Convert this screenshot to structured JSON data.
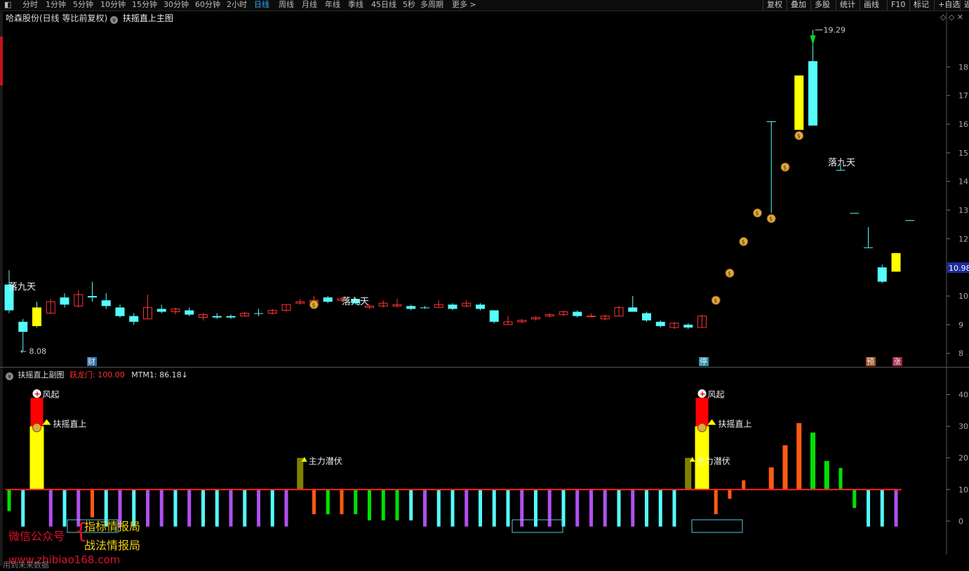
{
  "toolbar": {
    "periods": [
      "分时",
      "1分钟",
      "5分钟",
      "10分钟",
      "15分钟",
      "30分钟",
      "60分钟",
      "2小时",
      "日线",
      "周线",
      "月线",
      "年线",
      "季线",
      "45日线",
      "5秒",
      "多周期",
      "更多 >"
    ],
    "active": "日线",
    "right": [
      "复权",
      "叠加",
      "多股",
      "统计",
      "画线",
      "F10",
      "标记",
      "+自选",
      "返"
    ]
  },
  "main": {
    "stock_title": "哈森股份(日线 等比前复权)",
    "indicator": "扶摇直上主图",
    "high_label": "19.29",
    "low_label": "8.08",
    "current_price": "10.98",
    "price_axis": [
      "18",
      "17",
      "16",
      "15",
      "14",
      "13",
      "12",
      "11",
      "10",
      "9",
      "8"
    ],
    "annotations": [
      "落九天",
      "落九天",
      "落九天"
    ],
    "markers": [
      "财",
      "停",
      "预",
      "涨"
    ]
  },
  "sub": {
    "title": "扶摇直上副图",
    "line1_label": "跃龙门: 100.00",
    "line2_label": "MTM1: 86.18↓",
    "axis": [
      "40",
      "30",
      "20",
      "10",
      "0"
    ],
    "signals": [
      "风起",
      "扶摇直上",
      "主力潜伏",
      "风起",
      "扶摇直上",
      "主力潜伏"
    ]
  },
  "watermark": {
    "label": "微信公众号",
    "name1": "指标情报局",
    "name2": "战法情报局",
    "site": "www.zhibiao168.com"
  },
  "footer": "用到未来数据",
  "colors": {
    "up": "#ff3232",
    "down": "#54fcfc",
    "yellow": "#ffff00",
    "olive": "#808000",
    "purple": "#b050f0",
    "green": "#00e000",
    "orange": "#ff5a10",
    "redbar": "#ff0000"
  },
  "chart_data": {
    "type": "candlestick",
    "price_range": [
      7.6,
      19.6
    ],
    "candles": [
      {
        "o": 10.4,
        "c": 9.5,
        "h": 10.9,
        "l": 9.4
      },
      {
        "o": 9.1,
        "c": 8.75,
        "h": 9.2,
        "l": 8.08
      },
      {
        "o": 8.95,
        "c": 9.6,
        "h": 9.8,
        "l": 8.9
      },
      {
        "o": 9.4,
        "c": 9.8,
        "h": 9.9,
        "l": 9.4
      },
      {
        "o": 9.95,
        "c": 9.7,
        "h": 10.1,
        "l": 9.6
      },
      {
        "o": 9.65,
        "c": 10.05,
        "h": 10.2,
        "l": 9.6
      },
      {
        "o": 10.0,
        "c": 9.95,
        "h": 10.5,
        "l": 9.8
      },
      {
        "o": 9.85,
        "c": 9.65,
        "h": 10.1,
        "l": 9.55
      },
      {
        "o": 9.6,
        "c": 9.3,
        "h": 9.7,
        "l": 9.25
      },
      {
        "o": 9.3,
        "c": 9.1,
        "h": 9.4,
        "l": 9.0
      },
      {
        "o": 9.2,
        "c": 9.6,
        "h": 10.05,
        "l": 9.2
      },
      {
        "o": 9.55,
        "c": 9.45,
        "h": 9.7,
        "l": 9.4
      },
      {
        "o": 9.45,
        "c": 9.55,
        "h": 9.6,
        "l": 9.35
      },
      {
        "o": 9.5,
        "c": 9.35,
        "h": 9.6,
        "l": 9.3
      },
      {
        "o": 9.25,
        "c": 9.35,
        "h": 9.4,
        "l": 9.15
      },
      {
        "o": 9.3,
        "c": 9.25,
        "h": 9.4,
        "l": 9.2
      },
      {
        "o": 9.25,
        "c": 9.3,
        "h": 9.35,
        "l": 9.2
      },
      {
        "o": 9.3,
        "c": 9.4,
        "h": 9.45,
        "l": 9.3
      },
      {
        "o": 9.4,
        "c": 9.4,
        "h": 9.55,
        "l": 9.3
      },
      {
        "o": 9.4,
        "c": 9.5,
        "h": 9.55,
        "l": 9.35
      },
      {
        "o": 9.5,
        "c": 9.7,
        "h": 9.7,
        "l": 9.45
      },
      {
        "o": 9.75,
        "c": 9.8,
        "h": 9.9,
        "l": 9.7
      },
      {
        "o": 9.8,
        "c": 9.85,
        "h": 10.0,
        "l": 9.75
      },
      {
        "o": 9.95,
        "c": 9.8,
        "h": 10.0,
        "l": 9.75
      },
      {
        "o": 9.85,
        "c": 9.9,
        "h": 9.95,
        "l": 9.8
      },
      {
        "o": 9.9,
        "c": 9.75,
        "h": 9.95,
        "l": 9.7
      },
      {
        "o": 9.65,
        "c": 9.6,
        "h": 9.7,
        "l": 9.55
      },
      {
        "o": 9.65,
        "c": 9.75,
        "h": 9.85,
        "l": 9.6
      },
      {
        "o": 9.7,
        "c": 9.65,
        "h": 9.9,
        "l": 9.6
      },
      {
        "o": 9.65,
        "c": 9.55,
        "h": 9.7,
        "l": 9.5
      },
      {
        "o": 9.6,
        "c": 9.6,
        "h": 9.65,
        "l": 9.55
      },
      {
        "o": 9.6,
        "c": 9.7,
        "h": 9.85,
        "l": 9.6
      },
      {
        "o": 9.7,
        "c": 9.55,
        "h": 9.75,
        "l": 9.5
      },
      {
        "o": 9.65,
        "c": 9.75,
        "h": 9.85,
        "l": 9.6
      },
      {
        "o": 9.7,
        "c": 9.55,
        "h": 9.75,
        "l": 9.5
      },
      {
        "o": 9.5,
        "c": 9.1,
        "h": 9.5,
        "l": 9.05
      },
      {
        "o": 9.0,
        "c": 9.1,
        "h": 9.3,
        "l": 9.0
      },
      {
        "o": 9.1,
        "c": 9.15,
        "h": 9.2,
        "l": 9.05
      },
      {
        "o": 9.2,
        "c": 9.25,
        "h": 9.3,
        "l": 9.15
      },
      {
        "o": 9.3,
        "c": 9.35,
        "h": 9.4,
        "l": 9.25
      },
      {
        "o": 9.35,
        "c": 9.45,
        "h": 9.5,
        "l": 9.3
      },
      {
        "o": 9.45,
        "c": 9.3,
        "h": 9.5,
        "l": 9.25
      },
      {
        "o": 9.3,
        "c": 9.3,
        "h": 9.4,
        "l": 9.25
      },
      {
        "o": 9.3,
        "c": 9.2,
        "h": 9.35,
        "l": 9.15
      },
      {
        "o": 9.3,
        "c": 9.6,
        "h": 9.65,
        "l": 9.3
      },
      {
        "o": 9.6,
        "c": 9.45,
        "h": 10.0,
        "l": 9.45
      },
      {
        "o": 9.4,
        "c": 9.15,
        "h": 9.45,
        "l": 9.1
      },
      {
        "o": 9.1,
        "c": 8.95,
        "h": 9.15,
        "l": 8.9
      },
      {
        "o": 8.9,
        "c": 9.05,
        "h": 9.1,
        "l": 8.85
      },
      {
        "o": 9.0,
        "c": 8.9,
        "h": 9.05,
        "l": 8.85
      },
      {
        "o": 8.9,
        "c": 9.3,
        "h": 9.35,
        "l": 8.9
      },
      {
        "o": null,
        "c": null,
        "h": null,
        "l": null
      },
      {
        "o": null,
        "c": null,
        "h": null,
        "l": null
      },
      {
        "o": null,
        "c": null,
        "h": null,
        "l": null
      },
      {
        "o": null,
        "c": null,
        "h": null,
        "l": null
      },
      {
        "o": 16.1,
        "c": 16.1,
        "h": 16.1,
        "l": 12.9
      },
      {
        "o": null,
        "c": null,
        "h": null,
        "l": null
      },
      {
        "o": 15.8,
        "c": 17.7,
        "h": 17.7,
        "l": 15.8
      },
      {
        "o": 18.2,
        "c": 15.95,
        "h": 19.29,
        "l": 15.95
      },
      {
        "o": null,
        "c": null,
        "h": null,
        "l": null
      },
      {
        "o": 14.4,
        "c": 14.4,
        "h": 14.6,
        "l": 14.4
      },
      {
        "o": 12.9,
        "c": 12.9,
        "h": 12.9,
        "l": 12.9
      },
      {
        "o": 11.7,
        "c": 11.7,
        "h": 12.4,
        "l": 11.7
      },
      {
        "o": 11.0,
        "c": 10.5,
        "h": 11.1,
        "l": 10.45
      },
      {
        "o": 10.85,
        "c": 11.5,
        "h": 11.5,
        "l": 10.85
      },
      {
        "o": 12.65,
        "c": 12.65,
        "h": 12.65,
        "l": 12.65
      }
    ],
    "candle_colors": [
      "down",
      "down",
      "yellow",
      "up",
      "down",
      "up",
      "down",
      "down",
      "down",
      "down",
      "up",
      "down",
      "up",
      "down",
      "up",
      "down",
      "down",
      "up",
      "down",
      "up",
      "up",
      "up",
      "up",
      "down",
      "up",
      "down",
      "up",
      "up",
      "up",
      "down",
      "down",
      "up",
      "down",
      "up",
      "down",
      "down",
      "up",
      "up",
      "up",
      "up",
      "up",
      "down",
      "up",
      "up",
      "up",
      "down",
      "down",
      "down",
      "up",
      "down",
      "up",
      "none",
      "none",
      "none",
      "none",
      "down",
      "none",
      "yellow",
      "down",
      "none",
      "down",
      "down",
      "down",
      "down",
      "yellow",
      "down"
    ],
    "money_bags": [
      22,
      51,
      52,
      53,
      54,
      55,
      56,
      57,
      58
    ],
    "sub_range": [
      -6,
      45
    ],
    "sub_bars": [
      {
        "v": -7,
        "c": "green"
      },
      {
        "v": -12,
        "c": "down"
      },
      {
        "v": 30,
        "c": "yellow"
      },
      {
        "v": -12,
        "c": "purple"
      },
      {
        "v": -12,
        "c": "down"
      },
      {
        "v": -12,
        "c": "purple"
      },
      {
        "v": -9,
        "c": "orange"
      },
      {
        "v": -12,
        "c": "down"
      },
      {
        "v": -12,
        "c": "purple"
      },
      {
        "v": -12,
        "c": "down"
      },
      {
        "v": -12,
        "c": "purple"
      },
      {
        "v": -12,
        "c": "purple"
      },
      {
        "v": -12,
        "c": "down"
      },
      {
        "v": -12,
        "c": "purple"
      },
      {
        "v": -12,
        "c": "down"
      },
      {
        "v": -12,
        "c": "down"
      },
      {
        "v": -12,
        "c": "purple"
      },
      {
        "v": -12,
        "c": "down"
      },
      {
        "v": -12,
        "c": "purple"
      },
      {
        "v": -12,
        "c": "down"
      },
      {
        "v": -12,
        "c": "purple"
      },
      {
        "v": 20,
        "c": "olive"
      },
      {
        "v": -8,
        "c": "orange"
      },
      {
        "v": -8,
        "c": "green"
      },
      {
        "v": -8,
        "c": "orange"
      },
      {
        "v": -8,
        "c": "green"
      },
      {
        "v": -10,
        "c": "green"
      },
      {
        "v": -10,
        "c": "green"
      },
      {
        "v": -10,
        "c": "green"
      },
      {
        "v": -10,
        "c": "down"
      },
      {
        "v": -12,
        "c": "purple"
      },
      {
        "v": -12,
        "c": "down"
      },
      {
        "v": -12,
        "c": "down"
      },
      {
        "v": -12,
        "c": "purple"
      },
      {
        "v": -12,
        "c": "down"
      },
      {
        "v": -12,
        "c": "down"
      },
      {
        "v": -12,
        "c": "down"
      },
      {
        "v": -12,
        "c": "purple"
      },
      {
        "v": -12,
        "c": "down"
      },
      {
        "v": -12,
        "c": "purple"
      },
      {
        "v": -12,
        "c": "down"
      },
      {
        "v": -12,
        "c": "purple"
      },
      {
        "v": -12,
        "c": "purple"
      },
      {
        "v": -12,
        "c": "purple"
      },
      {
        "v": -12,
        "c": "down"
      },
      {
        "v": -12,
        "c": "purple"
      },
      {
        "v": -12,
        "c": "down"
      },
      {
        "v": -12,
        "c": "down"
      },
      {
        "v": -12,
        "c": "down"
      },
      {
        "v": 20,
        "c": "olive"
      },
      {
        "v": 30,
        "c": "yellow"
      },
      {
        "v": -8,
        "c": "orange"
      },
      {
        "v": -3,
        "c": "orange"
      },
      {
        "v": 3,
        "c": "orange"
      },
      {
        "v": 10,
        "c": "orange"
      },
      {
        "v": 17,
        "c": "orange"
      },
      {
        "v": 24,
        "c": "orange"
      },
      {
        "v": 31,
        "c": "orange"
      },
      {
        "v": 28,
        "c": "green"
      },
      {
        "v": 19,
        "c": "green"
      },
      {
        "v": 7,
        "c": "green"
      },
      {
        "v": -6,
        "c": "green"
      },
      {
        "v": -12,
        "c": "down"
      },
      {
        "v": -12,
        "c": "down"
      },
      {
        "v": -12,
        "c": "purple"
      }
    ],
    "baseline": 10,
    "red_bars": [
      {
        "i": 2,
        "from": 30,
        "to": 39
      },
      {
        "i": 50,
        "from": 30,
        "to": 39
      }
    ]
  }
}
